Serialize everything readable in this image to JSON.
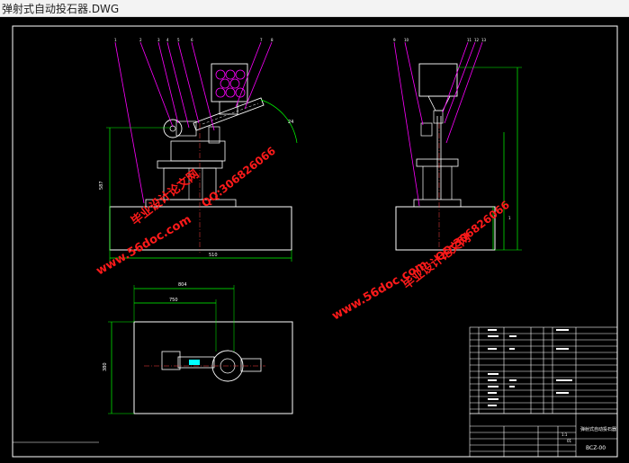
{
  "window": {
    "title": "弹射式自动投石器.DWG"
  },
  "drawing": {
    "background": "#000000",
    "colors": {
      "frame": "#ffffff",
      "leader": "#ff00ff",
      "dimension": "#00ff00",
      "hatch": "#ff00ff",
      "watermark": "#ff1a1a"
    },
    "dimensions": {
      "front_width": "510",
      "front_height": "587",
      "front_angle": "24",
      "side_height": "1",
      "plan_width": "804",
      "plan_inner": "750",
      "plan_depth": "380"
    },
    "title_block": {
      "title": "弹射式自动投石器",
      "code": "BCZ-00",
      "scale": "1:1",
      "sheet": "01"
    },
    "watermarks": {
      "site": "www.56doc.com",
      "brand": "毕业设计论文网",
      "qq": "QQ:306826066"
    }
  }
}
